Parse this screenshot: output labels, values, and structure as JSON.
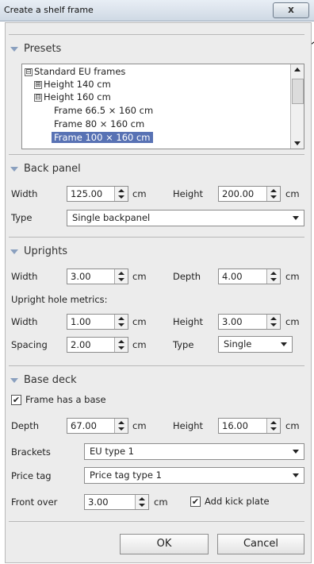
{
  "window": {
    "title": "Create a shelf frame",
    "close": "x"
  },
  "presets": {
    "header": "Presets",
    "tree": {
      "root": "Standard EU frames",
      "h140": "Height 140 cm",
      "h160": "Height 160 cm",
      "f665": "Frame 66.5 × 160 cm",
      "f80": "Frame 80 × 160 cm",
      "f100": "Frame 100 × 160 cm",
      "collapsed_sign": "⊞",
      "expanded_sign": "⊟"
    }
  },
  "back_panel": {
    "header": "Back panel",
    "width_label": "Width",
    "width_value": "125.00",
    "width_unit": "cm",
    "height_label": "Height",
    "height_value": "200.00",
    "height_unit": "cm",
    "type_label": "Type",
    "type_value": "Single backpanel"
  },
  "uprights": {
    "header": "Uprights",
    "width_label": "Width",
    "width_value": "3.00",
    "width_unit": "cm",
    "depth_label": "Depth",
    "depth_value": "4.00",
    "depth_unit": "cm",
    "hole_metrics_label": "Upright hole metrics:",
    "hole_width_label": "Width",
    "hole_width_value": "1.00",
    "hole_width_unit": "cm",
    "hole_height_label": "Height",
    "hole_height_value": "3.00",
    "hole_height_unit": "cm",
    "spacing_label": "Spacing",
    "spacing_value": "2.00",
    "spacing_unit": "cm",
    "type_label": "Type",
    "type_value": "Single"
  },
  "base_deck": {
    "header": "Base deck",
    "has_base_label": "Frame has a base",
    "has_base_checked": "✔",
    "depth_label": "Depth",
    "depth_value": "67.00",
    "depth_unit": "cm",
    "height_label": "Height",
    "height_value": "16.00",
    "height_unit": "cm",
    "brackets_label": "Brackets",
    "brackets_value": "EU type 1",
    "price_tag_label": "Price tag",
    "price_tag_value": "Price tag type 1",
    "front_over_label": "Front over",
    "front_over_value": "3.00",
    "front_over_unit": "cm",
    "kick_plate_label": "Add kick plate",
    "kick_plate_checked": "✔"
  },
  "buttons": {
    "ok": "OK",
    "cancel": "Cancel"
  },
  "colors": {
    "selection": "#5872b4",
    "section_arrow": "#8aa0bf"
  }
}
